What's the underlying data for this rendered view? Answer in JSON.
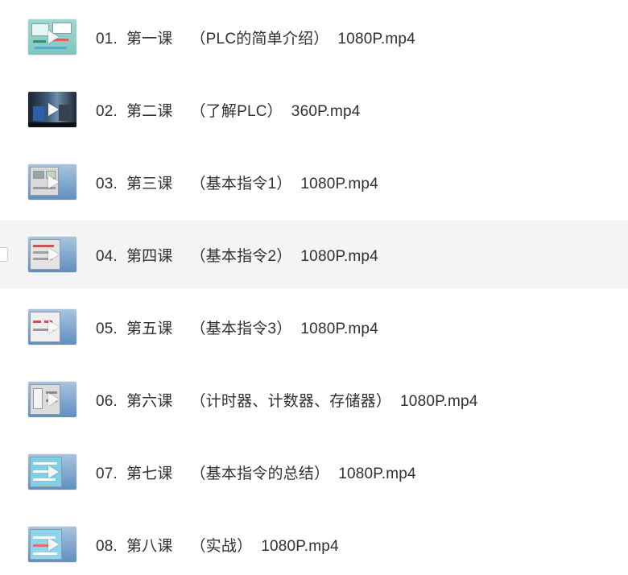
{
  "files": [
    {
      "name": "01.  第一课    （PLC的简单介绍）  1080P.mp4",
      "thumb": "software-screen-teal"
    },
    {
      "name": "02.  第二课    （了解PLC）  360P.mp4",
      "thumb": "classroom-video"
    },
    {
      "name": "03.  第三课    （基本指令1）  1080P.mp4",
      "thumb": "software-screen-gray"
    },
    {
      "name": "04.  第四课    （基本指令2）  1080P.mp4",
      "thumb": "software-screen-gray"
    },
    {
      "name": "05.  第五课    （基本指令3）  1080P.mp4",
      "thumb": "software-screen-gray"
    },
    {
      "name": "06.  第六课    （计时器、计数器、存储器）  1080P.mp4",
      "thumb": "software-screen-gray"
    },
    {
      "name": "07.  第七课    （基本指令的总结）  1080P.mp4",
      "thumb": "software-screen-cyan"
    },
    {
      "name": "08.  第八课    （实战）  1080P.mp4",
      "thumb": "software-screen-cyan"
    }
  ],
  "hovered_index": 3,
  "colors": {
    "text": "#303033",
    "hover_background": "#f4f4f4",
    "desktop_blue": "#4a7fb8"
  }
}
